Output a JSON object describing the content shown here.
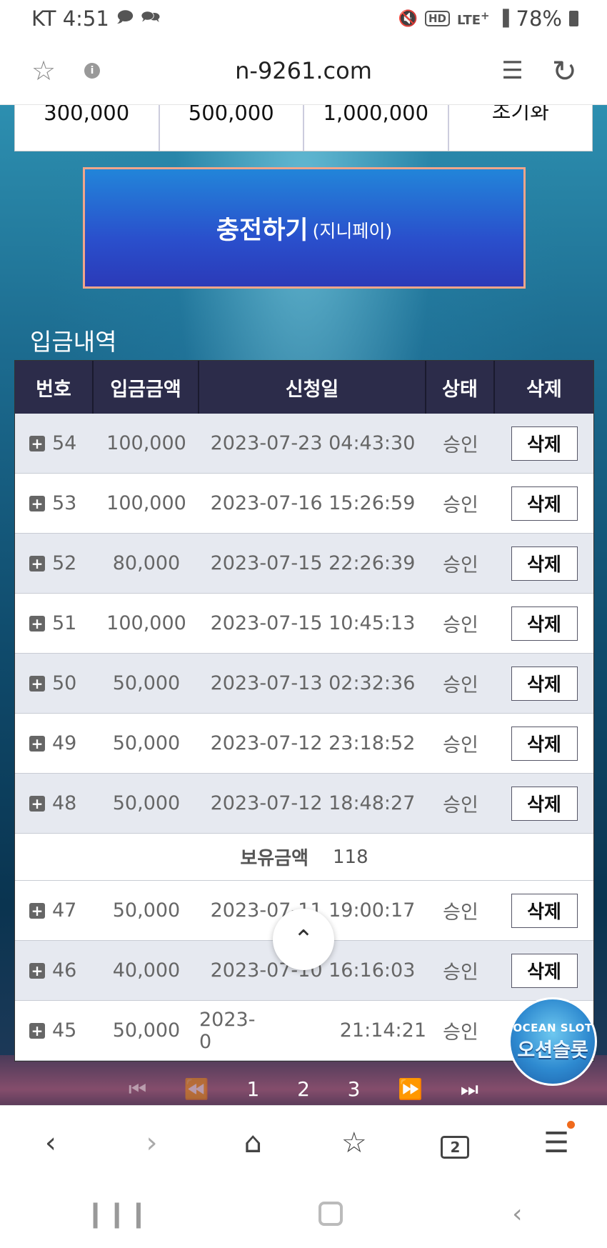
{
  "status_bar": {
    "carrier_time": "KT 4:51",
    "notification_icons": [
      "chat-bubble-icon",
      "chat-bubble-icon"
    ],
    "status_icons": [
      "mute-icon",
      "hd-icon",
      "lte-icon",
      "signal-icon"
    ],
    "battery": "78%"
  },
  "browser": {
    "url": "n-9261.com",
    "tabs_count": "2"
  },
  "amount_options": [
    "300,000",
    "500,000",
    "1,000,000",
    "초기화"
  ],
  "charge_button": {
    "main": "충전하기",
    "sub": "(지니페이)"
  },
  "history": {
    "title": "입금내역",
    "columns": [
      "번호",
      "입금금액",
      "신청일",
      "상태",
      "삭제"
    ],
    "rows_before_balance": [
      {
        "no": "54",
        "amount": "100,000",
        "date": "2023-07-23 04:43:30",
        "status": "승인",
        "action": "삭제"
      },
      {
        "no": "53",
        "amount": "100,000",
        "date": "2023-07-16 15:26:59",
        "status": "승인",
        "action": "삭제"
      },
      {
        "no": "52",
        "amount": "80,000",
        "date": "2023-07-15 22:26:39",
        "status": "승인",
        "action": "삭제"
      },
      {
        "no": "51",
        "amount": "100,000",
        "date": "2023-07-15 10:45:13",
        "status": "승인",
        "action": "삭제"
      },
      {
        "no": "50",
        "amount": "50,000",
        "date": "2023-07-13 02:32:36",
        "status": "승인",
        "action": "삭제"
      },
      {
        "no": "49",
        "amount": "50,000",
        "date": "2023-07-12 23:18:52",
        "status": "승인",
        "action": "삭제"
      },
      {
        "no": "48",
        "amount": "50,000",
        "date": "2023-07-12 18:48:27",
        "status": "승인",
        "action": "삭제"
      }
    ],
    "balance": {
      "label": "보유금액",
      "value": "118"
    },
    "rows_after_balance": [
      {
        "no": "47",
        "amount": "50,000",
        "date": "2023-07-11 19:00:17",
        "status": "승인",
        "action": "삭제"
      },
      {
        "no": "46",
        "amount": "40,000",
        "date": "2023-07-10 16:16:03",
        "status": "승인",
        "action": "삭제"
      },
      {
        "no": "45",
        "amount": "50,000",
        "date_left": "2023-0",
        "date_right": "21:14:21",
        "status": "승인"
      }
    ]
  },
  "pagination": {
    "pages": [
      "1",
      "2",
      "3"
    ],
    "icons": [
      "first-page-icon",
      "prev-page-icon",
      "next-page-icon",
      "last-page-icon"
    ]
  },
  "floating": {
    "logo_en": "OCEAN SLOT",
    "logo_kr": "오션슬롯"
  }
}
